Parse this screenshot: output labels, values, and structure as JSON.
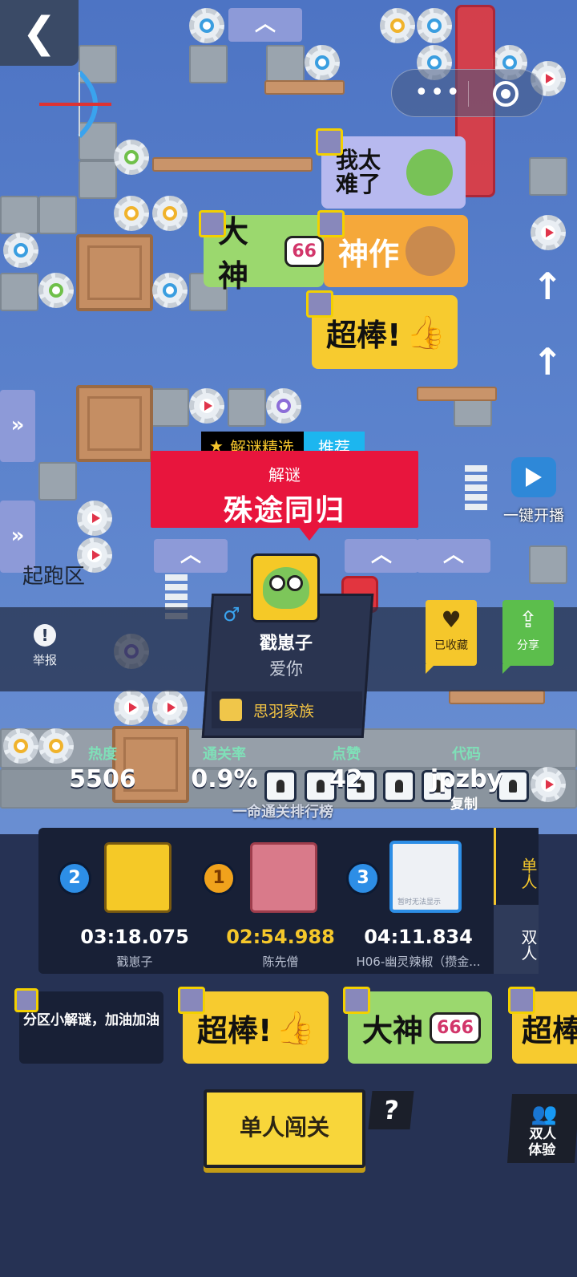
{
  "top": {
    "back_icon": "chevron-left-icon",
    "capsule_dots": "•••"
  },
  "board": {
    "stickers": [
      "我太难了",
      "大神",
      "66",
      "神作",
      "超棒!"
    ],
    "start_zone": "起跑区",
    "one_key_play": "一键开播"
  },
  "level": {
    "tag": "解谜精选",
    "tag_badge": "推荐",
    "category": "解谜",
    "title": "殊途同归"
  },
  "report": {
    "label": "举报"
  },
  "author": {
    "gender_symbol": "♂",
    "name": "戳崽子",
    "signature": "爱你",
    "clan": "思羽家族"
  },
  "actions": {
    "favorite": "已收藏",
    "share": "分享"
  },
  "stats": [
    {
      "label": "热度",
      "value": "5506"
    },
    {
      "label": "通关率",
      "value": "0.9%"
    },
    {
      "label": "点赞",
      "value": "42"
    },
    {
      "label": "代码",
      "value": "jpzby"
    }
  ],
  "copy_label": "复制",
  "leaderboard": {
    "title": "一命通关排行榜",
    "entries": [
      {
        "rank": "2",
        "time": "03:18.075",
        "name": "戳崽子"
      },
      {
        "rank": "1",
        "time": "02:54.988",
        "name": "陈先僧"
      },
      {
        "rank": "3",
        "time": "04:11.834",
        "name": "H06-幽灵辣椒（攒金..."
      }
    ],
    "broken_image_text": "暂时无法显示",
    "mode_single": "单人",
    "mode_double": "双人"
  },
  "comments": {
    "text": "分区小解谜，加油加油",
    "stickers": [
      "超棒!",
      "大神",
      "666",
      "超棒"
    ]
  },
  "buttons": {
    "play_single": "单人闯关",
    "help": "?",
    "duo_trial": "双人体验"
  },
  "colors": {
    "accent_yellow": "#f5c72b",
    "banner_red": "#e8153d",
    "share_green": "#5cbe4c",
    "badge_blue": "#1cb6ef"
  }
}
